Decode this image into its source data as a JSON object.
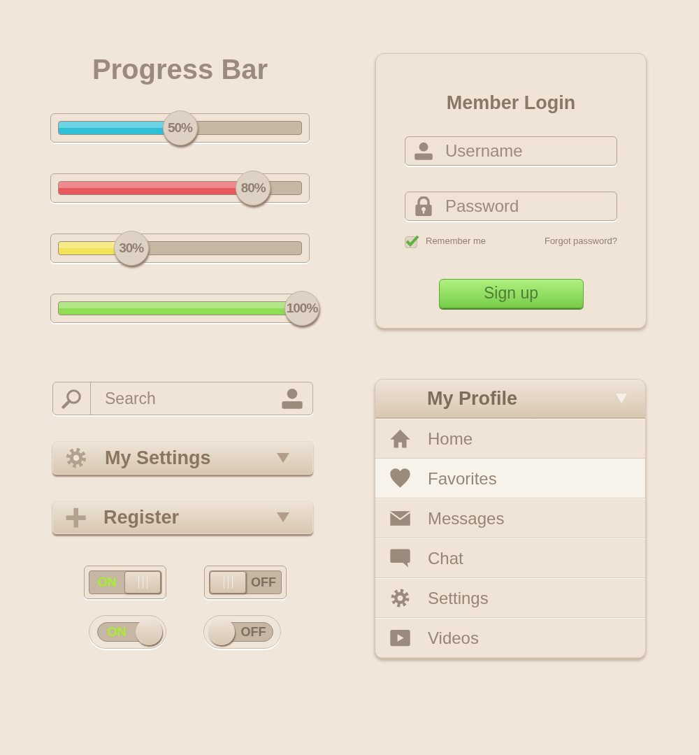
{
  "progress": {
    "title": "Progress Bar",
    "bars": [
      {
        "label": "50%",
        "level": 0.5,
        "color": "#2fbfd6"
      },
      {
        "label": "80%",
        "level": 0.8,
        "color": "#e8595d"
      },
      {
        "label": "30%",
        "level": 0.3,
        "color": "#f2e35a"
      },
      {
        "label": "100%",
        "level": 1,
        "color": "#8fdc55"
      }
    ]
  },
  "login": {
    "title": "Member Login",
    "username": {
      "placeholder": "Username"
    },
    "password": {
      "placeholder": "Password"
    },
    "remember": {
      "label": "Remember me",
      "checked": true
    },
    "forgot": "Forgot password?",
    "button": "Sign up"
  },
  "search": {
    "placeholder": "Search"
  },
  "dropdowns": [
    {
      "kind": "gear",
      "label": "My Settings"
    },
    {
      "kind": "plus",
      "label": "Register"
    }
  ],
  "toggles": [
    {
      "kind": "switch",
      "label": "ON",
      "on": true
    },
    {
      "kind": "switch",
      "label": "OFF",
      "on": false
    },
    {
      "kind": "pill",
      "label": "ON",
      "on": true
    },
    {
      "kind": "pill",
      "label": "OFF",
      "on": false
    }
  ],
  "profile": {
    "title": "My Profile",
    "items": [
      {
        "kind": "home",
        "label": "Home",
        "selected": false
      },
      {
        "kind": "heart",
        "label": "Favorites",
        "selected": true
      },
      {
        "kind": "mail",
        "label": "Messages",
        "selected": false
      },
      {
        "kind": "chat",
        "label": "Chat",
        "selected": false
      },
      {
        "kind": "gear",
        "label": "Settings",
        "selected": false
      },
      {
        "kind": "video",
        "label": "Videos",
        "selected": false
      }
    ]
  }
}
